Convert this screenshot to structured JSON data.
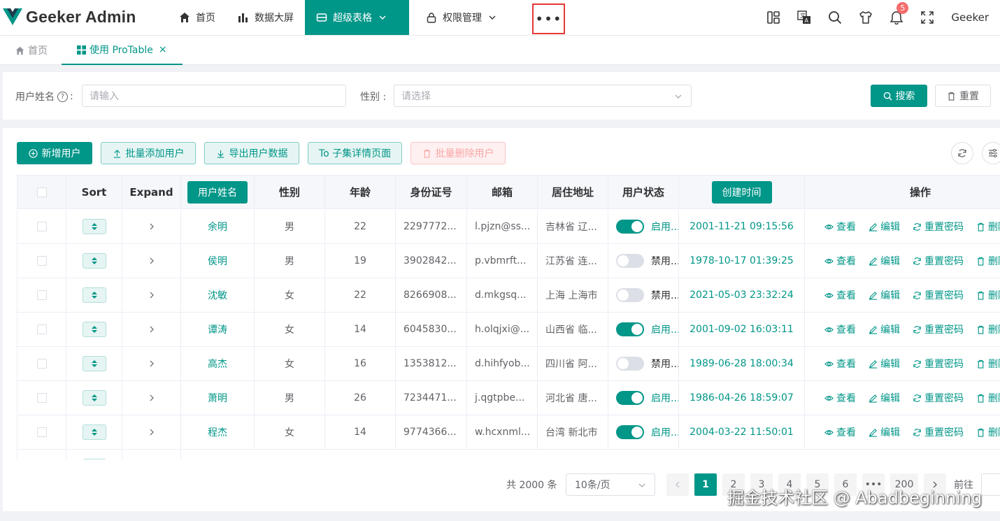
{
  "app": {
    "title": "Geeker Admin",
    "brand_color": "#009688"
  },
  "header": {
    "nav": [
      {
        "label": "首页",
        "icon": "home-icon"
      },
      {
        "label": "数据大屏",
        "icon": "bar-chart-icon"
      },
      {
        "label": "超级表格",
        "icon": "table-icon",
        "active": true
      },
      {
        "label": "权限管理",
        "icon": "lock-icon"
      }
    ],
    "more": "•••",
    "notification_count": "5",
    "username": "Geeker"
  },
  "tabs": [
    {
      "label": "首页",
      "icon": "home-icon"
    },
    {
      "label": "使用 ProTable",
      "icon": "grid-icon",
      "active": true,
      "close": "×"
    }
  ],
  "search": {
    "name_label": "用户姓名",
    "name_help": "?",
    "name_colon": ":",
    "name_placeholder": "请输入",
    "gender_label": "性别 :",
    "gender_placeholder": "请选择",
    "search_button": "搜索",
    "reset_button": "重置"
  },
  "toolbar": {
    "add": "新增用户",
    "batch_add": "批量添加用户",
    "export": "导出用户数据",
    "to_detail": "To 子集详情页面",
    "batch_delete": "批量删除用户"
  },
  "table": {
    "headers": [
      "Sort",
      "Expand",
      "用户姓名",
      "性别",
      "年龄",
      "身份证号",
      "邮箱",
      "居住地址",
      "用户状态",
      "创建时间",
      "操作"
    ],
    "ops": [
      "查看",
      "编辑",
      "重置密码",
      "删除"
    ],
    "rows": [
      {
        "name": "余明",
        "gender": "男",
        "age": "22",
        "id": "2297772...",
        "email": "l.pjzn@ss...",
        "address": "吉林省 辽...",
        "status": "启用...",
        "on": true,
        "created": "2001-11-21 09:15:56"
      },
      {
        "name": "侯明",
        "gender": "男",
        "age": "19",
        "id": "3902842...",
        "email": "p.vbmrft...",
        "address": "江苏省 连...",
        "status": "禁用...",
        "on": false,
        "created": "1978-10-17 01:39:25"
      },
      {
        "name": "沈敏",
        "gender": "女",
        "age": "22",
        "id": "8266908...",
        "email": "d.mkgsq...",
        "address": "上海 上海市",
        "status": "禁用...",
        "on": false,
        "created": "2021-05-03 23:32:24"
      },
      {
        "name": "谭涛",
        "gender": "女",
        "age": "14",
        "id": "6045830...",
        "email": "h.olqjxi@...",
        "address": "山西省 临...",
        "status": "启用...",
        "on": true,
        "created": "2001-09-02 16:03:11"
      },
      {
        "name": "高杰",
        "gender": "女",
        "age": "16",
        "id": "1353812...",
        "email": "d.hihfyob...",
        "address": "四川省 阿...",
        "status": "禁用...",
        "on": false,
        "created": "1989-06-28 18:00:34"
      },
      {
        "name": "萧明",
        "gender": "男",
        "age": "26",
        "id": "7234471...",
        "email": "j.qgtpbe...",
        "address": "河北省 唐...",
        "status": "启用...",
        "on": true,
        "created": "1986-04-26 18:59:07"
      },
      {
        "name": "程杰",
        "gender": "女",
        "age": "14",
        "id": "9774366...",
        "email": "w.hcxnml...",
        "address": "台湾 新北市",
        "status": "启用...",
        "on": true,
        "created": "2004-03-22 11:50:01"
      }
    ]
  },
  "pagination": {
    "total": "共 2000 条",
    "page_size": "10条/页",
    "pages": [
      "1",
      "2",
      "3",
      "4",
      "5",
      "6",
      "•••",
      "200"
    ],
    "current": "1",
    "jump_label": "前往"
  },
  "watermark": "掘金技术社区 @ Abadbeginning"
}
